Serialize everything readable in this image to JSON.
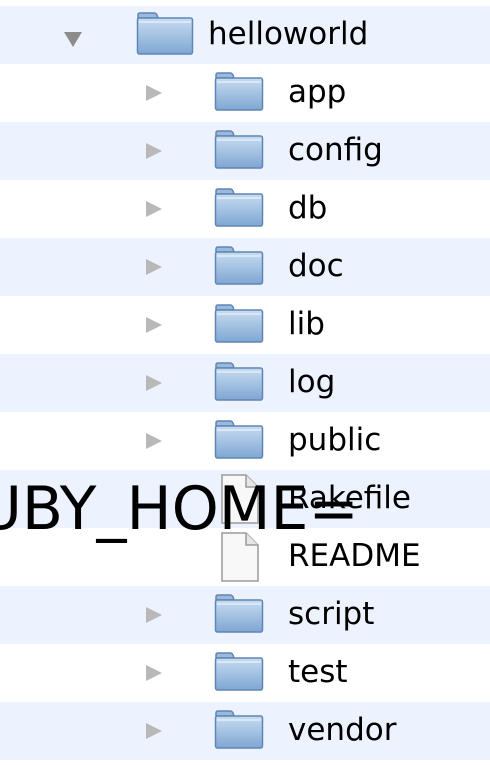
{
  "tree": {
    "root": {
      "label": "helloworld",
      "expanded": true,
      "icon": "folder-icon"
    },
    "children": [
      {
        "label": "app",
        "type": "folder",
        "icon": "folder-icon"
      },
      {
        "label": "config",
        "type": "folder",
        "icon": "folder-icon"
      },
      {
        "label": "db",
        "type": "folder",
        "icon": "folder-icon"
      },
      {
        "label": "doc",
        "type": "folder",
        "icon": "folder-icon"
      },
      {
        "label": "lib",
        "type": "folder",
        "icon": "folder-icon"
      },
      {
        "label": "log",
        "type": "folder",
        "icon": "folder-icon"
      },
      {
        "label": "public",
        "type": "folder",
        "icon": "folder-icon"
      },
      {
        "label": "Rakefile",
        "type": "file",
        "icon": "document-icon"
      },
      {
        "label": "README",
        "type": "file",
        "icon": "document-icon"
      },
      {
        "label": "script",
        "type": "folder",
        "icon": "folder-icon"
      },
      {
        "label": "test",
        "type": "folder",
        "icon": "folder-icon"
      },
      {
        "label": "vendor",
        "type": "folder",
        "icon": "folder-icon"
      }
    ]
  },
  "overlay_text": "UBY_HOME=",
  "colors": {
    "alternate_row": "#edf3fe",
    "folder_body": "#8fb4dc",
    "disclosure_triangle": "#b8b8b8"
  }
}
